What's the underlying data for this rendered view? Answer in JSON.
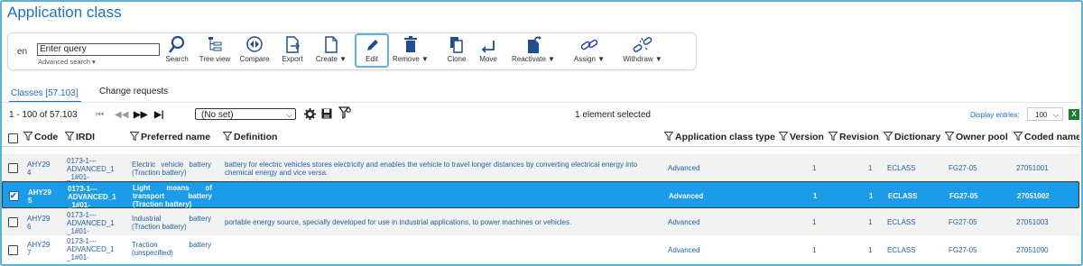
{
  "page": {
    "title": "Application class"
  },
  "search": {
    "lang": "en",
    "value": "Enter query",
    "advanced": "Advanced search ▾"
  },
  "toolbar": {
    "search": "Search",
    "tree_view": "Tree view",
    "compare": "Compare",
    "export": "Export",
    "create": "Create ▼",
    "edit": "Edit",
    "remove": "Remove ▼",
    "clone": "Clone",
    "move": "Move",
    "reactivate": "Reactivate ▼",
    "assign": "Assign ▼",
    "withdraw": "Withdraw ▼"
  },
  "tabs": {
    "classes": "Classes [57.103]",
    "changes": "Change requests"
  },
  "pager": {
    "range": "1 - 100 of 57.103",
    "filter_set": "(No set)",
    "selected": "1 element selected",
    "display_label": "Display entries:",
    "display_value": "100"
  },
  "columns": {
    "code": "Code",
    "irdi": "IRDI",
    "preferred_name": "Preferred name",
    "definition": "Definition",
    "app_type": "Application class type",
    "version": "Version",
    "revision": "Revision",
    "dictionary": "Dictionary",
    "owner_pool": "Owner pool",
    "coded_name": "Coded name"
  },
  "rows": [
    {
      "code1": "AHY29",
      "code2": "4",
      "irdi1": "0173-1---",
      "irdi2": "ADVANCED_1",
      "irdi3": "_1#01-",
      "name1": "Electric vehicle battery",
      "name2": "(Traction battery)",
      "name3": "",
      "def1": "battery for electric vehicles stores electricity and enables the vehicle to travel longer distances by converting electrical energy into",
      "def2": "chemical energy and vice versa.",
      "type": "Advanced",
      "version": "1",
      "revision": "1",
      "dictionary": "ECLASS",
      "owner": "FG27-05",
      "coded": "27051001"
    },
    {
      "code1": "AHY29",
      "code2": "5",
      "irdi1": "0173-1---",
      "irdi2": "ADVANCED_1",
      "irdi3": "_1#01-",
      "name1": "Light means of",
      "name2": "transport battery",
      "name3": "(Traction battery)",
      "def1": "",
      "def2": "",
      "type": "Advanced",
      "version": "1",
      "revision": "1",
      "dictionary": "ECLASS",
      "owner": "FG27-05",
      "coded": "27051002"
    },
    {
      "code1": "AHY29",
      "code2": "6",
      "irdi1": "0173-1---",
      "irdi2": "ADVANCED_1",
      "irdi3": "_1#01-",
      "name1": "Industrial battery",
      "name2": "(Traction battery)",
      "name3": "",
      "def1": "portable energy source, specially developed for use in industrial applications, to power machines or vehicles.",
      "def2": "",
      "type": "Advanced",
      "version": "1",
      "revision": "1",
      "dictionary": "ECLASS",
      "owner": "FG27-05",
      "coded": "27051003"
    },
    {
      "code1": "AHY29",
      "code2": "7",
      "irdi1": "0173-1---",
      "irdi2": "ADVANCED_1",
      "irdi3": "_1#01-",
      "name1": "Traction battery",
      "name2": "(unspecified)",
      "name3": "",
      "def1": "",
      "def2": "",
      "type": "Advanced",
      "version": "1",
      "revision": "1",
      "dictionary": "ECLASS",
      "owner": "FG27-05",
      "coded": "27051090"
    }
  ],
  "colors": {
    "accent": "#1f6fbf",
    "selected_row": "#1a9ce8",
    "frame": "#5ab2d6"
  }
}
